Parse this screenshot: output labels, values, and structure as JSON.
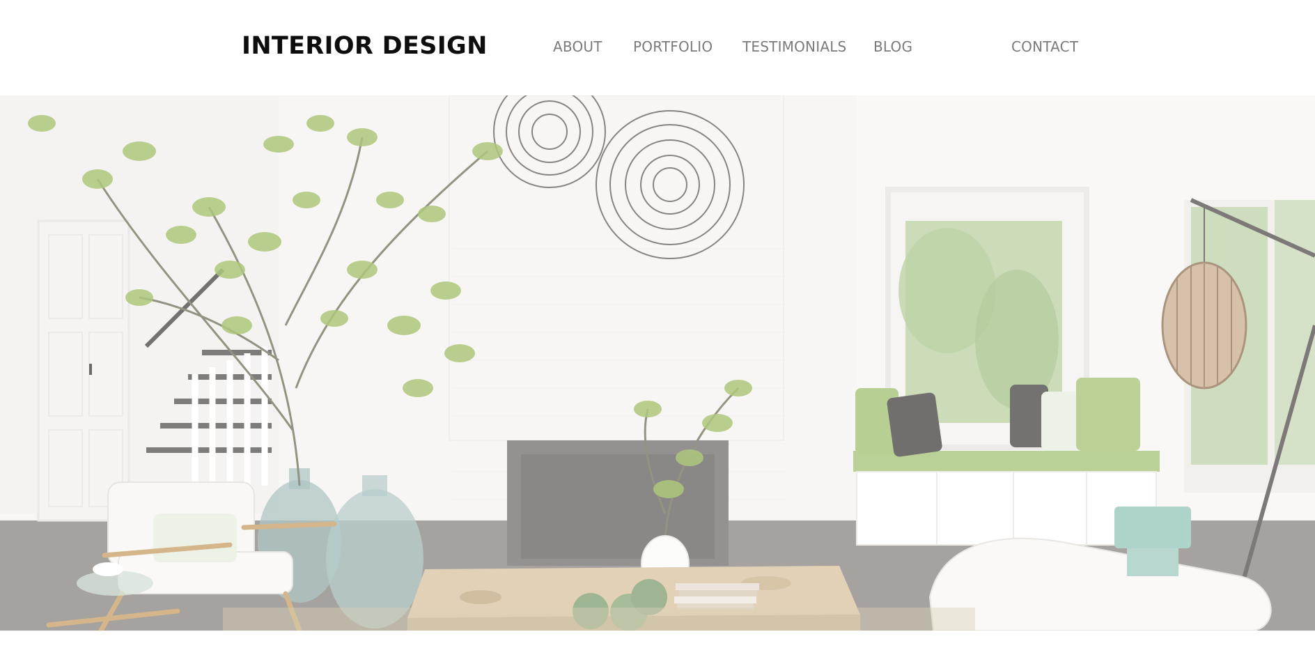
{
  "brand": {
    "title": "INTERIOR DESIGN"
  },
  "nav": {
    "items": [
      {
        "label": "ABOUT"
      },
      {
        "label": "PORTFOLIO"
      },
      {
        "label": "TESTIMONIALS"
      },
      {
        "label": "BLOG"
      },
      {
        "label": "CONTACT"
      }
    ]
  },
  "hero": {
    "image": "living-room-photo",
    "tone": "faded-white-overlay",
    "colors": {
      "wall": "#f6f4f0",
      "foliage": "#8fb24a",
      "wood_floor": "#5a5552",
      "fireplace": "#6a6866",
      "glass_vase": "#8fb0ad",
      "wicker": "#b9a37e"
    }
  }
}
